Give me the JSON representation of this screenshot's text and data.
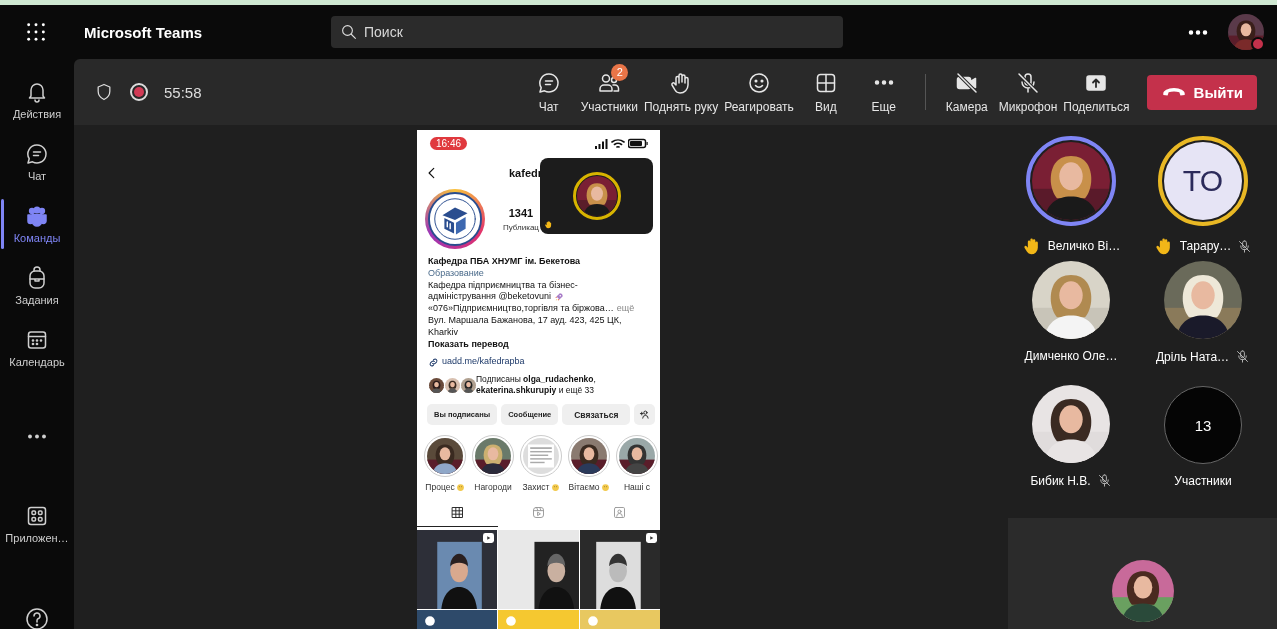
{
  "app": {
    "title": "Microsoft Teams"
  },
  "search": {
    "placeholder": "Поиск"
  },
  "user": {
    "busy": true
  },
  "rail": [
    {
      "label": "Действия",
      "selected": false
    },
    {
      "label": "Чат",
      "selected": false
    },
    {
      "label": "Команды",
      "selected": true
    },
    {
      "label": "Задания",
      "selected": false
    },
    {
      "label": "Календарь",
      "selected": false
    },
    {
      "kind": "more",
      "selected": false
    },
    {
      "label": "Приложен…",
      "selected": false
    }
  ],
  "meeting": {
    "timer": "55:58",
    "recording": true
  },
  "controls": [
    {
      "label": "Чат",
      "off": false
    },
    {
      "label": "Участники",
      "badge": "2",
      "off": false
    },
    {
      "label": "Поднять руку",
      "off": false
    },
    {
      "label": "Реагировать",
      "off": false
    },
    {
      "label": "Вид",
      "off": false
    },
    {
      "label": "Еще",
      "off": false
    },
    {
      "kind": "divider"
    },
    {
      "label": "Камера",
      "off": true
    },
    {
      "label": "Микрофон",
      "off": true
    },
    {
      "label": "Поделиться",
      "off": false
    }
  ],
  "leave_button": {
    "label": "Выйти"
  },
  "shared_screen": {
    "time": "16:46",
    "username": "kafedr",
    "posts_count": "1341",
    "posts_label": "Публикац",
    "display_name": "Кафедра ПБА ХНУМГ ім. Бекетова",
    "category": "Образование",
    "bio": [
      {
        "text": "Кафедра підприємництва та бізнес-",
        "emoji": false
      },
      {
        "text": "адміністрування @beketovuni",
        "emoji": true
      },
      {
        "text": "«076»Підприємництво,торгівля та біржова…",
        "more": "ещё",
        "emoji": false
      },
      {
        "text": "Вул. Маршала Бажанова, 17 ауд. 423, 425 ЦК,",
        "emoji": false
      },
      {
        "text": "Kharkiv",
        "emoji": false
      }
    ],
    "translate": "Показать перевод",
    "link": "uadd.me/kafedrapba",
    "followed_by": "Подписаны **olga_rudachenko**, **ekaterina.shkurupiy** и ещё 33",
    "buttons": [
      "Вы подписаны",
      "Сообщение",
      "Связаться"
    ],
    "highlights": [
      {
        "label": "Процес",
        "emoji": true
      },
      {
        "label": "Нагороди",
        "emoji": false
      },
      {
        "label": "Захист",
        "emoji": true
      },
      {
        "label": "Вітаємо",
        "emoji": true
      },
      {
        "label": "Наші с",
        "emoji": false
      }
    ],
    "tabs": [
      {
        "selected": true
      },
      {
        "selected": false
      },
      {
        "selected": false
      }
    ],
    "posts": [
      {
        "reel": true
      },
      {
        "reel": false
      },
      {
        "reel": true
      },
      {
        "reel": false
      },
      {
        "reel": false
      },
      {
        "reel": false
      }
    ]
  },
  "participants": [
    {
      "name": "Величко Ві…",
      "speaking": true,
      "hand_raised": true,
      "muted": false
    },
    {
      "name": "Тарару…",
      "kind": "initials",
      "initials": "ТО",
      "speaking": false,
      "hand_raised": true,
      "muted": true
    },
    {
      "name": "Димченко Оле…",
      "speaking": false,
      "hand_raised": false,
      "muted": false
    },
    {
      "name": "Дріль Ната…",
      "speaking": false,
      "hand_raised": false,
      "muted": true
    },
    {
      "name": "Бибик Н.В.",
      "speaking": false,
      "hand_raised": false,
      "muted": true
    }
  ],
  "overflow": {
    "count": "13",
    "label": "Участники"
  }
}
